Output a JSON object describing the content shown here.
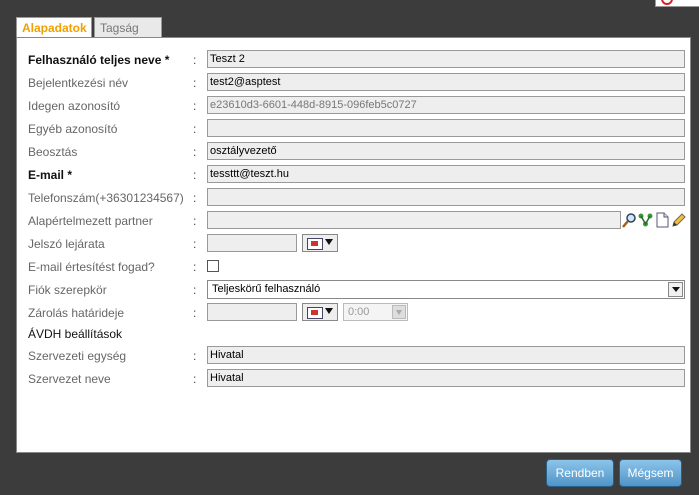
{
  "tabs": [
    {
      "label": "Alapadatok",
      "active": true
    },
    {
      "label": "Tagság",
      "active": false
    }
  ],
  "form": {
    "full_name": {
      "label": "Felhasználó teljes neve *",
      "value": "Teszt 2"
    },
    "login_name": {
      "label": "Bejelentkezési név",
      "value": "test2@asptest"
    },
    "foreign_id": {
      "label": "Idegen azonosító",
      "value": "e23610d3-6601-448d-8915-096feb5c0727"
    },
    "other_id": {
      "label": "Egyéb azonosító",
      "value": ""
    },
    "position": {
      "label": "Beosztás",
      "value": "osztályvezető"
    },
    "email": {
      "label": "E-mail *",
      "value": "tessttt@teszt.hu"
    },
    "phone": {
      "label": "Telefonszám(+36301234567)",
      "value": ""
    },
    "default_partner": {
      "label": "Alapértelmezett partner",
      "value": ""
    },
    "password_expiry": {
      "label": "Jelszó lejárata",
      "value": ""
    },
    "email_notify": {
      "label": "E-mail értesítést fogad?",
      "checked": false
    },
    "account_role": {
      "label": "Fiók szerepkör",
      "value": "Teljeskörű felhasználó"
    },
    "lock_deadline": {
      "label": "Zárolás határideje",
      "value": "",
      "time": "0:00"
    },
    "avdh_section": "ÁVDH beállítások",
    "org_unit": {
      "label": "Szervezeti egység",
      "value": "Hivatal"
    },
    "org_name": {
      "label": "Szervezet neve",
      "value": "Hivatal"
    }
  },
  "colon": ":",
  "buttons": {
    "ok": "Rendben",
    "cancel": "Mégsem"
  },
  "colors": {
    "accent_tab": "#f0a000",
    "button_top": "#8cc4ea",
    "button_bottom": "#4f95c8"
  },
  "icons": [
    "search-icon",
    "tree-icon",
    "document-icon",
    "edit-icon",
    "calendar-icon"
  ]
}
